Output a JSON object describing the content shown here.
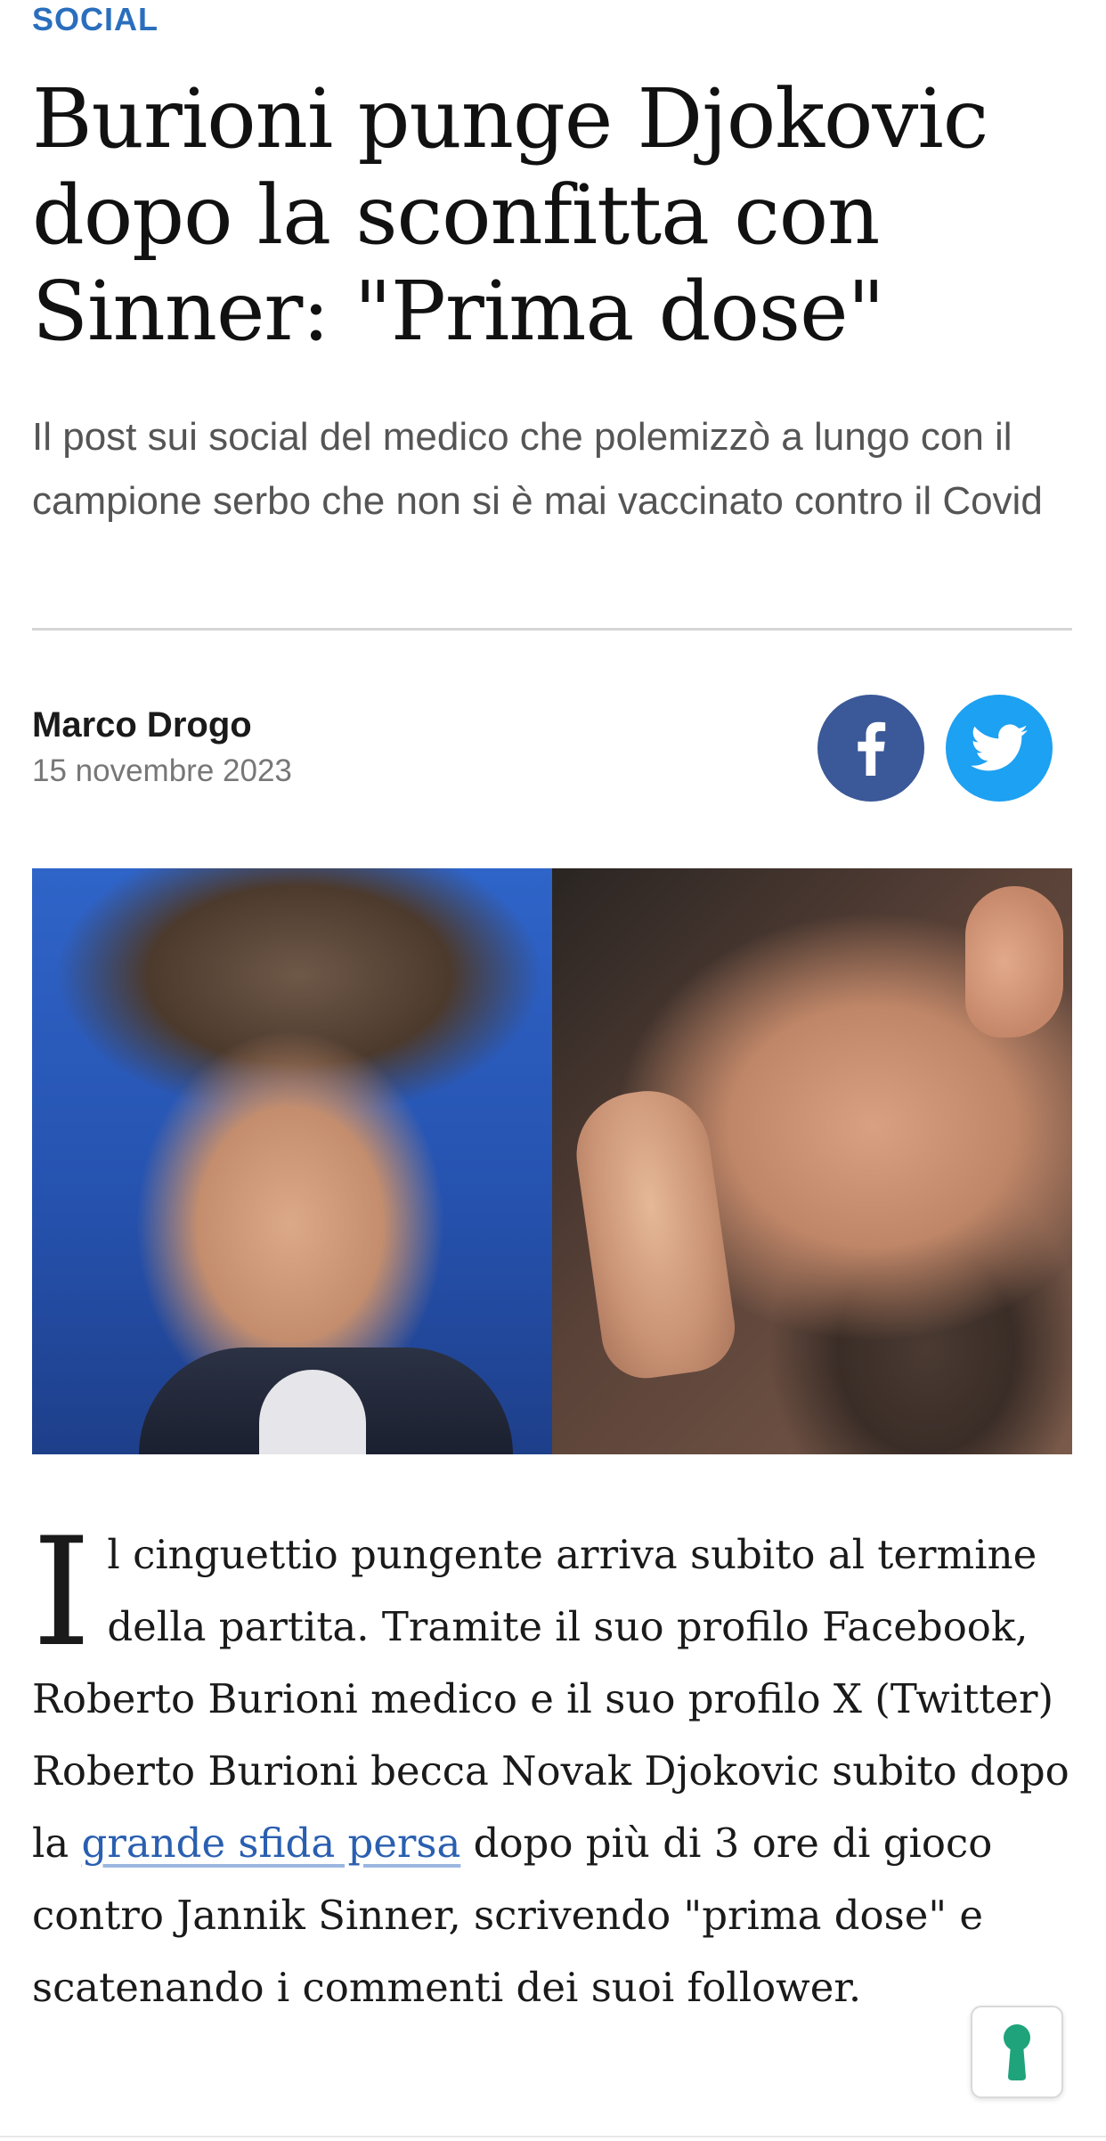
{
  "section": {
    "label": "SOCIAL"
  },
  "article": {
    "headline": "Burioni punge Djokovic dopo la sconfitta con Sinner: \"Prima dose\"",
    "subtitle": "Il post sui social del medico che polemizzò a lungo con il campione serbo che non si è mai vaccinato contro il Covid",
    "author": "Marco Drogo",
    "date": "15 novembre 2023",
    "body": {
      "dropcap": "I",
      "p1_start": "l cinguettio pungente arriva subito al termine della partita. Tramite il suo profilo Facebook, Roberto Burioni medico e il suo profilo X (Twitter) Roberto Burioni becca Novak Djokovic subito dopo la ",
      "link": "grande sfida persa",
      "p1_end": " dopo più di 3 ore di gioco contro Jannik Sinner, scrivendo \"prima dose\" e scatenando i commenti dei suoi follower."
    }
  },
  "share": {
    "facebook_icon": "facebook-icon",
    "twitter_icon": "twitter-icon",
    "facebook_color": "#3b5998",
    "twitter_color": "#1da1f2"
  },
  "floating_button": {
    "icon": "keyhole-icon",
    "color": "#1fa37a"
  },
  "colors": {
    "accent": "#2a6fbd",
    "link": "#2a5fb0"
  }
}
